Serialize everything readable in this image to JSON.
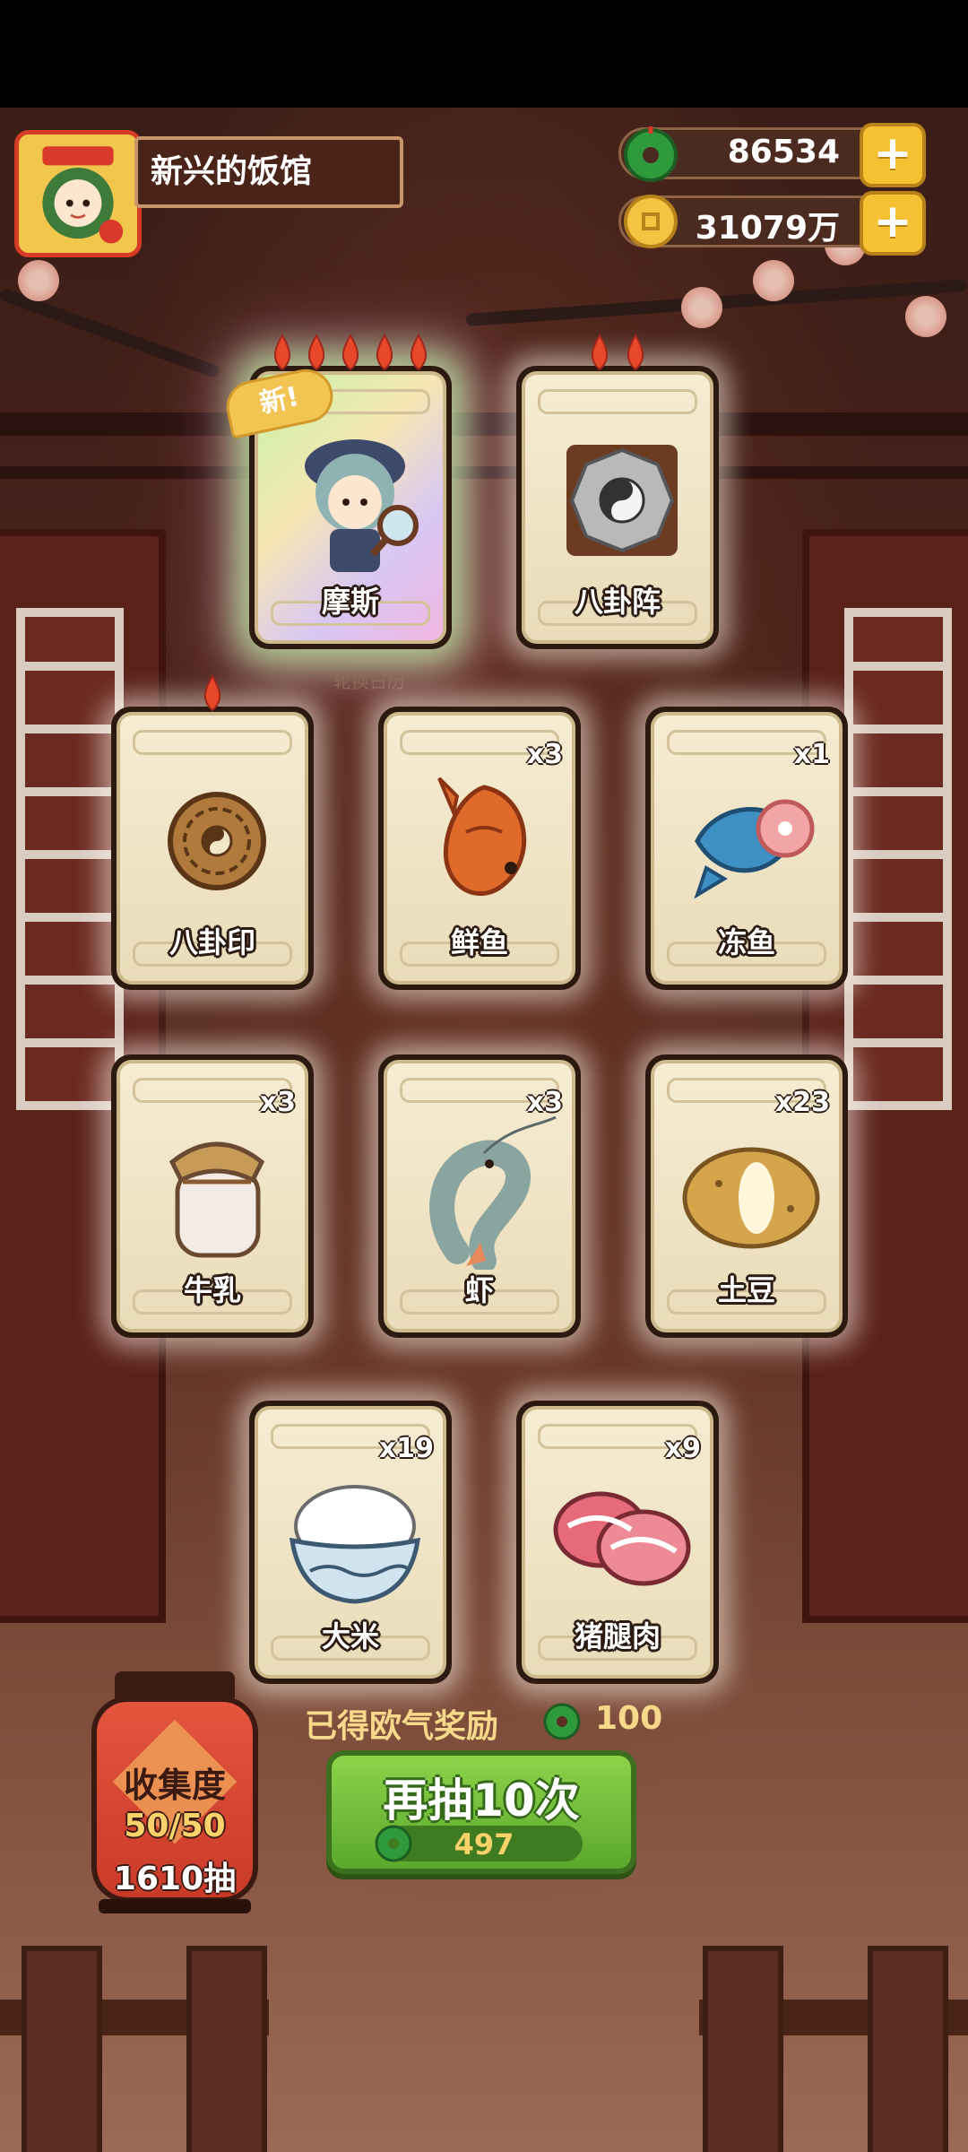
{
  "header": {
    "shop_name": "新兴的饭馆",
    "jade_amount": "86534",
    "coin_amount": "31079万",
    "plus_label": "+"
  },
  "featured_cards": [
    {
      "name": "摩斯",
      "flames": 5,
      "new_label": "新!",
      "rarity": "rainbow",
      "icon": "detective-character"
    },
    {
      "name": "八卦阵",
      "flames": 2,
      "rarity": "gold",
      "icon": "bagua-array"
    }
  ],
  "calendar_label": "轮换日历",
  "cards": [
    {
      "name": "八卦印",
      "count": "",
      "flames": 1,
      "icon": "bagua-seal"
    },
    {
      "name": "鲜鱼",
      "count": "x3",
      "icon": "fresh-fish"
    },
    {
      "name": "冻鱼",
      "count": "x1",
      "icon": "frozen-fish"
    },
    {
      "name": "牛乳",
      "count": "x3",
      "icon": "milk-jar"
    },
    {
      "name": "虾",
      "count": "x3",
      "icon": "shrimp"
    },
    {
      "name": "土豆",
      "count": "x23",
      "icon": "potato"
    },
    {
      "name": "大米",
      "count": "x19",
      "icon": "rice-bowl"
    },
    {
      "name": "猪腿肉",
      "count": "x9",
      "icon": "pork-leg"
    }
  ],
  "reward": {
    "label": "已得欧气奖励",
    "value": "100"
  },
  "redraw_button": {
    "label": "再抽10次",
    "cost": "497"
  },
  "collection": {
    "title": "收集度",
    "progress": "50/50",
    "draws": "1610抽"
  },
  "colors": {
    "accent_green": "#5ba82d",
    "gold": "#f6c133",
    "lantern_red": "#d43e2a"
  }
}
